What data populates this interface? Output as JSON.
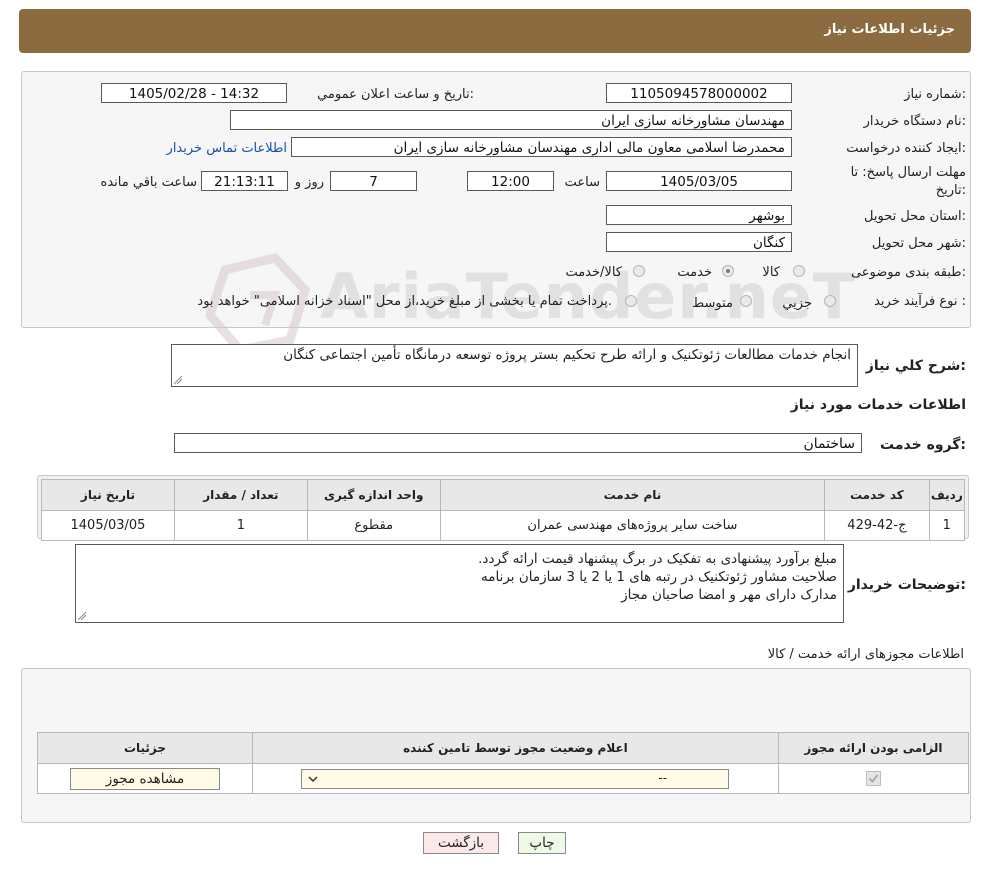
{
  "header": {
    "title": "جزئیات اطلاعات نیاز"
  },
  "form": {
    "need_number": {
      "label": "شماره نیاز:",
      "value": "1105094578000002"
    },
    "announce_datetime": {
      "label": "تاریخ و ساعت اعلان عمومي:",
      "value": "1405/02/28 - 14:32"
    },
    "buyer_org": {
      "label": "نام دستگاه خريدار:",
      "value": "مهندسان مشاورخانه سازی ایران"
    },
    "creator": {
      "label": "ايجاد کننده درخواست:",
      "value": "محمدرضا اسلامی معاون مالی اداری مهندسان مشاورخانه سازی ایران",
      "contact_link": "اطلاعات تماس خريدار"
    },
    "deadline": {
      "label_line1": "مهلت ارسال پاسخ: تا",
      "label_line2": "تاريخ:",
      "date": "1405/03/05",
      "time_label": "ساعت",
      "time": "12:00",
      "days": "7",
      "days_label": "روز و",
      "remaining": "21:13:11",
      "remaining_label": "ساعت باقي مانده"
    },
    "province": {
      "label": "استان محل تحويل:",
      "value": "بوشهر"
    },
    "city": {
      "label": "شهر محل تحويل:",
      "value": "کنگان"
    },
    "category": {
      "label": "طبقه بندی موضوعی:",
      "options": [
        "کالا",
        "خدمت",
        "کالا/خدمت"
      ],
      "selected": "خدمت"
    },
    "purchase_type": {
      "label": "نوع فرآيند خريد :",
      "options": [
        "جزیي",
        "متوسط"
      ],
      "note": "پرداخت تمام یا بخشی از مبلغ خرید،از محل \"اسناد خزانه اسلامی\" خواهد بود."
    },
    "description": {
      "label": "شرح کلي نياز:",
      "value": "انجام خدمات مطالعات ژئوتکنیک و ارائه طرح تحکیم بستر پروژه توسعه درمانگاه تأمین اجتماعی کنگان"
    },
    "services_title": "اطلاعات خدمات مورد نياز",
    "service_group": {
      "label": "گروه خدمت:",
      "value": "ساختمان"
    }
  },
  "services_table": {
    "headers": [
      "رديف",
      "کد خدمت",
      "نام خدمت",
      "واحد اندازه گيری",
      "تعداد / مقدار",
      "تاريخ نياز"
    ],
    "rows": [
      [
        "1",
        "ج-42-429",
        "ساخت سایر پروژه‌های مهندسی عمران",
        "مقطوع",
        "1",
        "1405/03/05"
      ]
    ]
  },
  "buyer_notes": {
    "label": "توضيحات خريدار:",
    "lines": [
      "مبلغ برآورد پیشنهادی به تفکیک در برگ پیشنهاد قیمت ارائه گردد.",
      "صلاحیت مشاور ژئوتکنیک در رتبه های 1 یا 2 یا 3 سازمان برنامه",
      "مدارک دارای مهر و امضا صاحبان مجاز"
    ]
  },
  "permits": {
    "title": "اطلاعات مجوزهای ارائه خدمت / کالا",
    "headers": [
      "الزامی بودن ارائه مجوز",
      "اعلام وضعيت مجوز توسط تامين کننده",
      "جزئيات"
    ],
    "select_value": "--",
    "view_button": "مشاهده مجوز"
  },
  "buttons": {
    "print": "چاپ",
    "back": "بازگشت"
  },
  "watermark": "AriaTender.neT"
}
